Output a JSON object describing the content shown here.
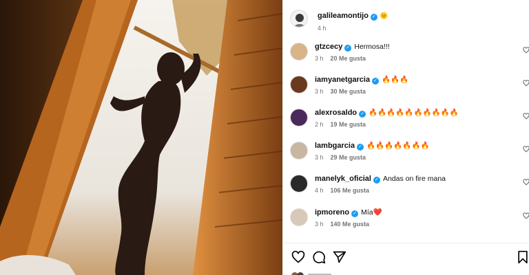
{
  "post": {
    "author": "galileamontijo",
    "emoji": "🌞",
    "time": "4 h"
  },
  "comments": [
    {
      "user": "gtzcecy",
      "text": "Hermosa!!!",
      "time": "3 h",
      "likes": "20 Me gusta",
      "avatar_color": "#d9b48a"
    },
    {
      "user": "iamyanetgarcia",
      "text": "🔥🔥🔥",
      "time": "3 h",
      "likes": "30 Me gusta",
      "avatar_color": "#6b3a1e"
    },
    {
      "user": "alexrosaldo",
      "text": "🔥🔥🔥🔥🔥🔥🔥🔥🔥🔥",
      "time": "2 h",
      "likes": "19 Me gusta",
      "avatar_color": "#4a2a5a"
    },
    {
      "user": "lambgarcia",
      "text": "🔥🔥🔥🔥🔥🔥🔥",
      "time": "3 h",
      "likes": "29 Me gusta",
      "avatar_color": "#c9b6a0"
    },
    {
      "user": "manelyk_oficial",
      "text": "Andas on fire mana",
      "time": "4 h",
      "likes": "106 Me gusta",
      "avatar_color": "#2a2a2a"
    },
    {
      "user": "ipmoreno",
      "text": "Mía❤️",
      "time": "3 h",
      "likes": "140 Me gusta",
      "avatar_color": "#d8c8b8"
    }
  ],
  "colors": {
    "verified": "#1d9bf0",
    "muted_text": "#737373"
  },
  "icons": [
    "like-icon",
    "comment-icon",
    "share-icon",
    "save-icon",
    "verified-icon"
  ]
}
